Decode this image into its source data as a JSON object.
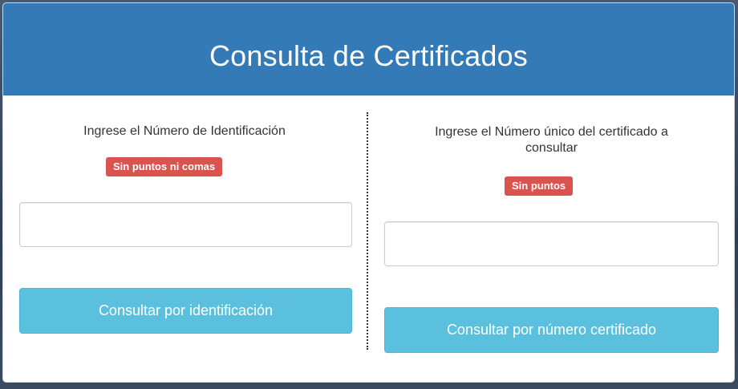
{
  "header": {
    "title": "Consulta de Certificados"
  },
  "left": {
    "label": "Ingrese el Número de Identificación",
    "badge": "Sin puntos ni comas",
    "input_value": "",
    "button_label": "Consultar por identificación"
  },
  "right": {
    "label_line1": "Ingrese el Número único del certificado a",
    "label_line2": "consultar",
    "badge": "Sin puntos",
    "input_value": "",
    "button_label": "Consultar por número certificado"
  },
  "colors": {
    "header_bg": "#337ab7",
    "badge_bg": "#d9534f",
    "button_bg": "#5bc0de"
  }
}
